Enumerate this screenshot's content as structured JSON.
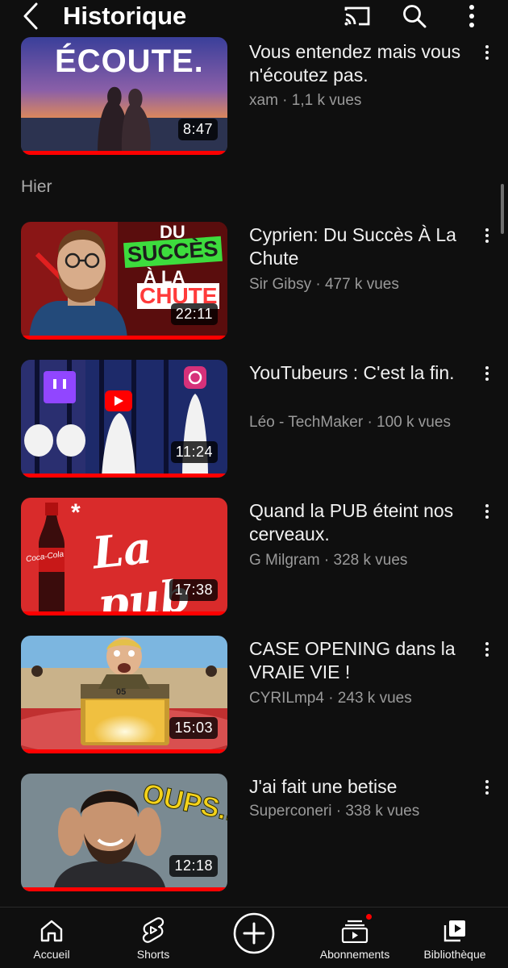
{
  "header": {
    "title": "Historique",
    "icons": [
      "back-arrow-icon",
      "cast-icon",
      "search-icon",
      "more-vertical-icon"
    ]
  },
  "section": {
    "label": "Hier"
  },
  "videos": [
    {
      "title": "Vous entendez mais vous n'écoutez pas.",
      "channel": "xam",
      "views": "1,1 k vues",
      "meta": "xam · 1,1 k vues",
      "duration": "8:47",
      "thumb_text": "ÉCOUTE."
    },
    {
      "title": "Cyprien: Du Succès À La Chute",
      "channel": "Sir Gibsy",
      "views": "477 k vues",
      "meta": "Sir Gibsy · 477 k vues",
      "duration": "22:11",
      "thumb_text": [
        "DU",
        "SUCCÈS",
        "À LA",
        "CHUTE"
      ]
    },
    {
      "title": "YouTubeurs : C'est la fin.",
      "channel": "Léo - TechMaker",
      "views": "100 k vues",
      "meta": "Léo - TechMaker · 100 k vues",
      "duration": "11:24"
    },
    {
      "title": "Quand la PUB éteint nos cerveaux.",
      "channel": "G Milgram",
      "views": "328 k vues",
      "meta": "G Milgram · 328 k vues",
      "duration": "17:38",
      "thumb_text": [
        "La pub",
        "Coca-Cola",
        "*"
      ]
    },
    {
      "title": "CASE OPENING dans la VRAIE VIE !",
      "channel": "CYRILmp4",
      "views": "243 k vues",
      "meta": "CYRILmp4 · 243 k vues",
      "duration": "15:03",
      "thumb_text": "05"
    },
    {
      "title": "J'ai fait une betise",
      "channel": "Superconeri",
      "views": "338 k vues",
      "meta": "Superconeri · 338 k vues",
      "duration": "12:18",
      "thumb_text": "OUPS..."
    }
  ],
  "bottom_nav": [
    {
      "label": "Accueil",
      "icon": "home-icon"
    },
    {
      "label": "Shorts",
      "icon": "shorts-icon"
    },
    {
      "label": "",
      "icon": "create-plus-icon"
    },
    {
      "label": "Abonnements",
      "icon": "subscriptions-icon"
    },
    {
      "label": "Bibliothèque",
      "icon": "library-icon"
    }
  ],
  "colors": {
    "background": "#0f0f0f",
    "progress": "#ff0000",
    "meta_text": "#9a9a9a",
    "notification_dot": "#ff0000"
  }
}
